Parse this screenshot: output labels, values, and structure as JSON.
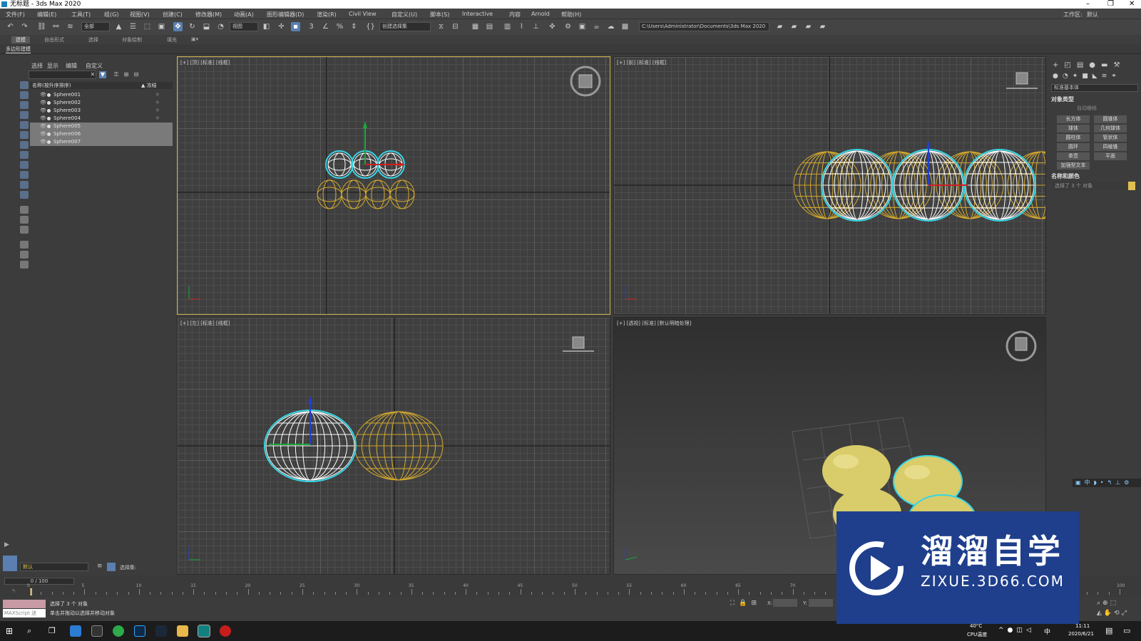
{
  "titlebar": {
    "title": "无标题 - 3ds Max 2020",
    "workspace_label": "工作区:",
    "workspace_value": "默认"
  },
  "menu": [
    "文件(F)",
    "编辑(E)",
    "工具(T)",
    "组(G)",
    "视图(V)",
    "创建(C)",
    "修改器(M)",
    "动画(A)",
    "图形编辑器(D)",
    "渲染(R)",
    "Civil View",
    "自定义(U)",
    "脚本(S)",
    "Interactive",
    "内容",
    "Arnold",
    "帮助(H)"
  ],
  "toolbar": {
    "selection_filter": "全部",
    "ref_coord": "视图",
    "named_selection": "创建选择集",
    "project_path": "C:\\Users\\Administrator\\Documents\\3ds Max 2020"
  },
  "ribbon": {
    "tabs": [
      "建模",
      "自由形式",
      "选择",
      "对象绘制",
      "填充"
    ],
    "sub": "多边形建模"
  },
  "explorer": {
    "tabs": [
      "选择",
      "显示",
      "编辑",
      "自定义"
    ],
    "col_name": "名称(按升序排序)",
    "col_frozen": "▲ 冻结",
    "objects": [
      {
        "name": "Sphere001",
        "selected": false
      },
      {
        "name": "Sphere002",
        "selected": false
      },
      {
        "name": "Sphere003",
        "selected": false
      },
      {
        "name": "Sphere004",
        "selected": false
      },
      {
        "name": "Sphere005",
        "selected": true
      },
      {
        "name": "Sphere006",
        "selected": true
      },
      {
        "name": "Sphere007",
        "selected": true
      }
    ],
    "layer_default": "默认",
    "selection_set_label": "选择集:"
  },
  "viewports": {
    "top": "[+] [顶] [标准] [线框]",
    "front": "[+] [前] [标准] [线框]",
    "left": "[+] [左] [标准] [线框]",
    "persp": "[+] [透视] [标准] [默认明暗处理]"
  },
  "command_panel": {
    "category": "标准基本体",
    "rollout_object_type": "对象类型",
    "autogrid": "自动栅格",
    "buttons": [
      "长方体",
      "圆锥体",
      "球体",
      "几何球体",
      "圆柱体",
      "管状体",
      "圆环",
      "四棱锥",
      "茶壶",
      "平面",
      "加强型文本"
    ],
    "rollout_name_color": "名称和颜色",
    "name_field": "选择了 3 个 对象",
    "object_color": "#e0c050"
  },
  "timeline": {
    "frame": "0 / 100",
    "ticks": [
      "0",
      "5",
      "10",
      "15",
      "20",
      "25",
      "30",
      "35",
      "40",
      "45",
      "50",
      "55",
      "60",
      "65",
      "70",
      "75",
      "80",
      "85",
      "90",
      "95",
      "100"
    ]
  },
  "status": {
    "selected": "选择了 3 个 对象",
    "hint": "单击并拖动以选择并移动对象",
    "maxscript": "MAXScript 迷",
    "x_label": "X:",
    "y_label": "Y:"
  },
  "taskbar": {
    "temp": "40°C",
    "cpu": "CPU温度",
    "time": "11:11",
    "date": "2020/6/21",
    "ime": "中"
  },
  "watermark": {
    "brand_cn": "溜溜自学",
    "brand_url": "ZIXUE.3D66.COM"
  },
  "colors": {
    "wire_unselected": "#d4aa2e",
    "wire_selected": "#ffffff",
    "selection_outline": "#35d6e6",
    "sphere_fill": "#d9cc6a",
    "active_border": "#c9b04a",
    "watermark_bg": "#1f3f8c"
  }
}
